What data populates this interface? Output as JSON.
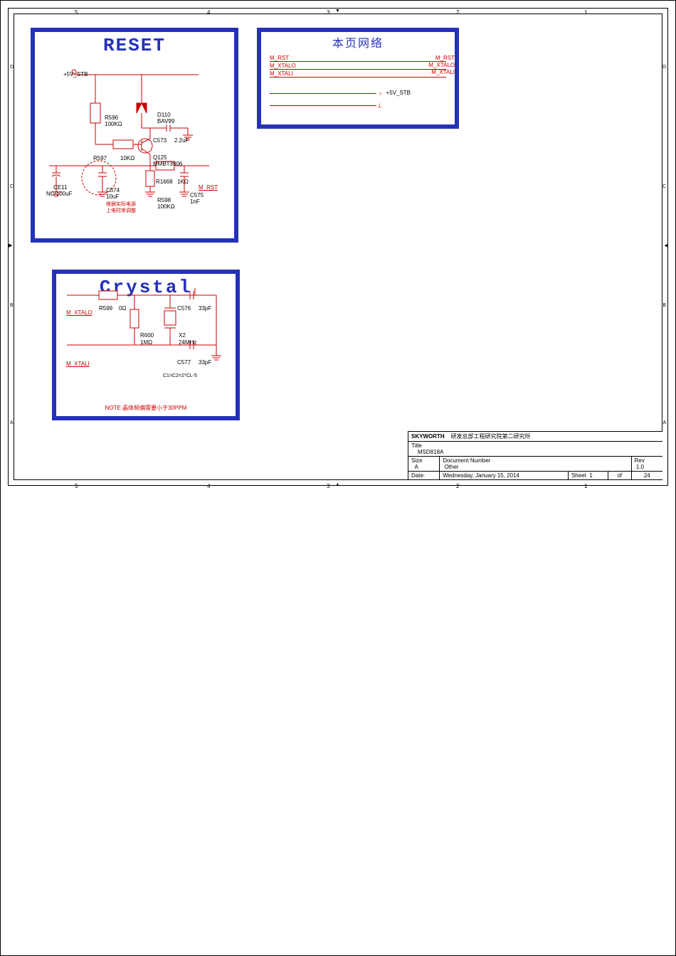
{
  "reset_block": {
    "title": "RESET",
    "power_rail": "+5V_STB",
    "components": {
      "R596": {
        "ref": "R596",
        "value": "100KΩ"
      },
      "R597": {
        "ref": "R597",
        "value": "10KΩ"
      },
      "R598": {
        "ref": "R598",
        "value": "100KΩ"
      },
      "R1668": {
        "ref": "R1668",
        "value": "1KΩ"
      },
      "D110": {
        "ref": "D110",
        "value": "BAV99"
      },
      "C573": {
        "ref": "C573",
        "value": "2.2uF"
      },
      "C574": {
        "ref": "C574",
        "value": "10uF"
      },
      "C575": {
        "ref": "C575",
        "value": "1nF"
      },
      "CE11": {
        "ref": "CE11",
        "value": "NC/100uF"
      },
      "Q125": {
        "ref": "Q125",
        "value": "MMBT3906"
      }
    },
    "note": "根据实际电源\n上电时序调整",
    "output_net": "M_RST"
  },
  "net_block": {
    "title": "本页网络",
    "left_nets": [
      "M_RST",
      "M_XTALO",
      "M_XTALI"
    ],
    "right_nets": [
      "M_RST",
      "M_XTALO",
      "M_XTALI"
    ],
    "power_out": "+5V_STB"
  },
  "crystal_block": {
    "title": "Crystal",
    "nets": {
      "out": "M_XTALO",
      "in": "M_XTALI"
    },
    "components": {
      "R599": {
        "ref": "R599",
        "value": "0Ω"
      },
      "R600": {
        "ref": "R600",
        "value": "1MΩ"
      },
      "X2": {
        "ref": "X2",
        "value": "24MHz"
      },
      "C576": {
        "ref": "C576",
        "value": "33pF"
      },
      "C577": {
        "ref": "C577",
        "value": "33pF"
      }
    },
    "formula": "C1=C2=2*CL-5",
    "note": "NOTE:晶体频偏需要小于30PPM"
  },
  "title_block": {
    "company": "SKYWORTH",
    "dept": "研发总部工程研究院第二研究所",
    "title_label": "Title",
    "title": "MSD818A",
    "size_label": "Size",
    "size": "A",
    "docnum_label": "Document Number",
    "docnum": "Other",
    "rev_label": "Rev",
    "rev": "1.0",
    "date_label": "Date:",
    "date": "Wednesday, January 15, 2014",
    "sheet_label": "Sheet",
    "sheet": "1",
    "of_label": "of",
    "total": "24"
  },
  "border": {
    "col_labels": [
      "5",
      "4",
      "3",
      "2",
      "1"
    ],
    "row_labels": [
      "D",
      "C",
      "B",
      "A"
    ]
  },
  "arrows": {
    "left": "◀",
    "right": "▶",
    "up": "▲",
    "down": "▼"
  }
}
